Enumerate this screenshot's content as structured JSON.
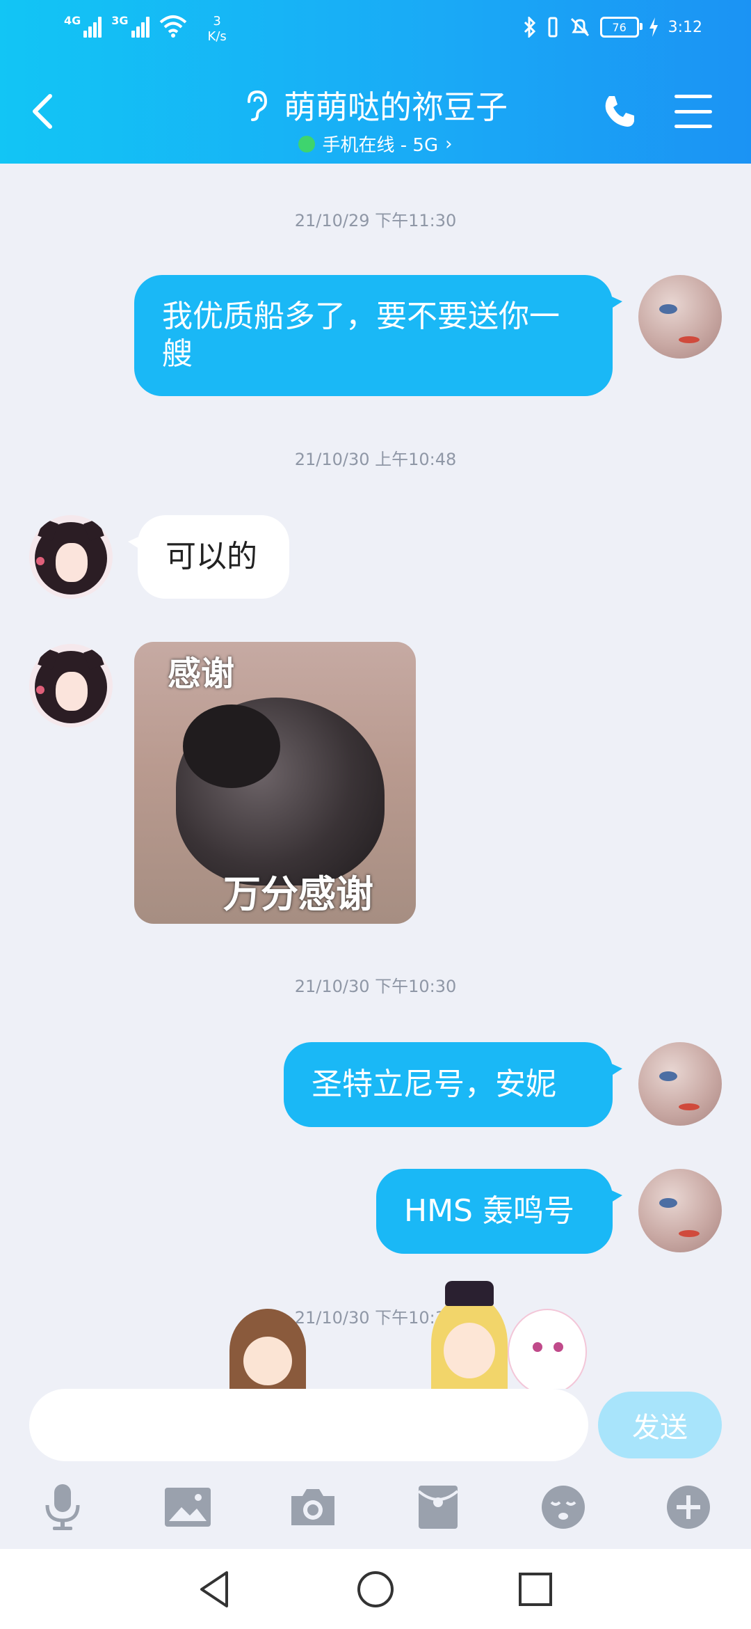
{
  "status_bar": {
    "signal1_label": "4G",
    "signal2_label": "3G",
    "speed_value": "3",
    "speed_unit": "K/s",
    "battery_level": "76",
    "time": "3:12"
  },
  "header": {
    "contact_name": "萌萌哒的祢豆子",
    "online_status": "手机在线 - 5G",
    "status_chevron": "›"
  },
  "messages": [
    {
      "timestamp": "21/10/29  下午11:30",
      "sender": "self",
      "text": "我优质船多了，要不要送你一艘"
    },
    {
      "timestamp": "21/10/30  上午10:48",
      "sender": "other",
      "text": "可以的"
    },
    {
      "sender": "other",
      "type": "sticker",
      "top_text": "感谢",
      "bottom_text": "万分感谢"
    },
    {
      "timestamp": "21/10/30  下午10:30",
      "sender": "self",
      "text": "圣特立尼号，安妮"
    },
    {
      "sender": "self",
      "text": "HMS  轰鸣号"
    },
    {
      "timestamp": "21/10/30  下午10:32"
    }
  ],
  "input": {
    "placeholder": "",
    "send_label": "发送"
  },
  "toolbar_icons": [
    "microphone-icon",
    "picture-icon",
    "camera-icon",
    "red-packet-icon",
    "emoji-icon",
    "plus-icon"
  ],
  "colors": {
    "header_gradient_start": "#12c5f5",
    "header_gradient_end": "#1b93f4",
    "self_bubble": "#1ab8f6",
    "background": "#eef0f7",
    "send_button": "#a8e4fb"
  }
}
